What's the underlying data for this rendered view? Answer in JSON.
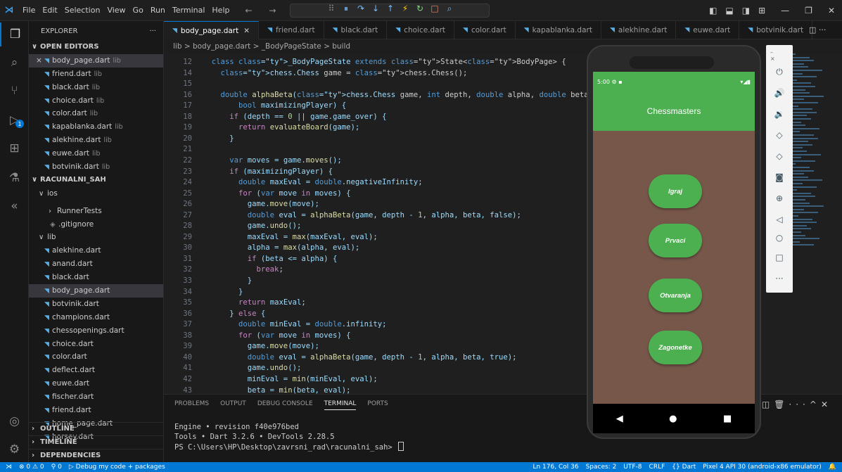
{
  "titlebar": {
    "menu": [
      "File",
      "Edit",
      "Selection",
      "View",
      "Go",
      "Run",
      "Terminal",
      "Help"
    ],
    "nav_arrows": "← →"
  },
  "explorer": {
    "title": "EXPLORER",
    "more": "···",
    "open_editors_label": "OPEN EDITORS",
    "open_editors": [
      {
        "name": "body_page.dart",
        "hint": "lib",
        "active": true
      },
      {
        "name": "friend.dart",
        "hint": "lib"
      },
      {
        "name": "black.dart",
        "hint": "lib"
      },
      {
        "name": "choice.dart",
        "hint": "lib"
      },
      {
        "name": "color.dart",
        "hint": "lib"
      },
      {
        "name": "kapablanka.dart",
        "hint": "lib"
      },
      {
        "name": "alekhine.dart",
        "hint": "lib"
      },
      {
        "name": "euwe.dart",
        "hint": "lib"
      },
      {
        "name": "botvinik.dart",
        "hint": "lib"
      }
    ],
    "project_label": "RACUNALNI_SAH",
    "ios_label": "ios",
    "runner_tests": "RunnerTests",
    "gitignore": ".gitignore",
    "lib_label": "lib",
    "lib_files": [
      "alekhine.dart",
      "anand.dart",
      "black.dart",
      "body_page.dart",
      "botvinik.dart",
      "champions.dart",
      "chessopenings.dart",
      "choice.dart",
      "color.dart",
      "deflect.dart",
      "euwe.dart",
      "fischer.dart",
      "friend.dart",
      "home_page.dart",
      "horsey.dart"
    ],
    "outline": "OUTLINE",
    "timeline": "TIMELINE",
    "dependencies": "DEPENDENCIES"
  },
  "tabs": [
    {
      "label": "body_page.dart",
      "active": true
    },
    {
      "label": "friend.dart"
    },
    {
      "label": "black.dart"
    },
    {
      "label": "choice.dart"
    },
    {
      "label": "color.dart"
    },
    {
      "label": "kapablanka.dart"
    },
    {
      "label": "alekhine.dart"
    },
    {
      "label": "euwe.dart"
    },
    {
      "label": "botvinik.dart"
    }
  ],
  "breadcrumb": "lib > body_page.dart > _BodyPageState > build",
  "code": {
    "line_numbers": [
      "12",
      "14",
      "15",
      "16",
      "17",
      "18",
      "19",
      "20",
      "21",
      "22",
      "23",
      "24",
      "25",
      "26",
      "27",
      "28",
      "29",
      "30",
      "31",
      "32",
      "33",
      "34",
      "35",
      "36",
      "37",
      "38",
      "39",
      "40",
      "41",
      "42",
      "43"
    ],
    "lines": [
      "  class _BodyPageState extends State<BodyPage> {",
      "    chess.Chess game = chess.Chess();",
      "",
      "    double alphaBeta(chess.Chess game, int depth, double alpha, double beta,",
      "        bool maximizingPlayer) {",
      "      if (depth == 0 || game.game_over) {",
      "        return evaluateBoard(game);",
      "      }",
      "",
      "      var moves = game.moves();",
      "      if (maximizingPlayer) {",
      "        double maxEval = double.negativeInfinity;",
      "        for (var move in moves) {",
      "          game.move(move);",
      "          double eval = alphaBeta(game, depth - 1, alpha, beta, false);",
      "          game.undo();",
      "          maxEval = max(maxEval, eval);",
      "          alpha = max(alpha, eval);",
      "          if (beta <= alpha) {",
      "            break;",
      "          }",
      "        }",
      "        return maxEval;",
      "      } else {",
      "        double minEval = double.infinity;",
      "        for (var move in moves) {",
      "          game.move(move);",
      "          double eval = alphaBeta(game, depth - 1, alpha, beta, true);",
      "          game.undo();",
      "          minEval = min(minEval, eval);",
      "          beta = min(beta, eval);"
    ]
  },
  "panel": {
    "tabs": [
      "PROBLEMS",
      "OUTPUT",
      "DEBUG CONSOLE",
      "TERMINAL",
      "PORTS"
    ],
    "active_tab": "TERMINAL",
    "terminal_lines": [
      "Engine • revision f40e976bed",
      "Tools • Dart 3.2.6 • DevTools 2.28.5",
      "PS C:\\Users\\HP\\Desktop\\zavrsni_rad\\racunalni_sah> "
    ]
  },
  "statusbar": {
    "errors": "⊗ 0 ⚠ 0",
    "ports": "0",
    "debug": "Debug my code + packages",
    "position": "Ln 176, Col 36",
    "spaces": "Spaces: 2",
    "encoding": "UTF-8",
    "eol": "CRLF",
    "language": "{} Dart",
    "device": "Pixel 4 API 30 (android-x86 emulator)"
  },
  "phone": {
    "time": "5:00",
    "app_title": "Chessmasters",
    "buttons": [
      "Igraj",
      "Prvaci",
      "Otvaranja",
      "Zagonetke"
    ],
    "background_color": "#77574a",
    "accent_color": "#4caf50"
  },
  "emulator_tools": [
    "power-icon",
    "volume-up-icon",
    "volume-down-icon",
    "rotate-left-icon",
    "rotate-right-icon",
    "camera-icon",
    "zoom-icon",
    "back-icon",
    "home-icon",
    "overview-icon",
    "more-icon"
  ],
  "colors": {
    "status_bar": "#0078d4",
    "editor_bg": "#1f1f1f"
  }
}
